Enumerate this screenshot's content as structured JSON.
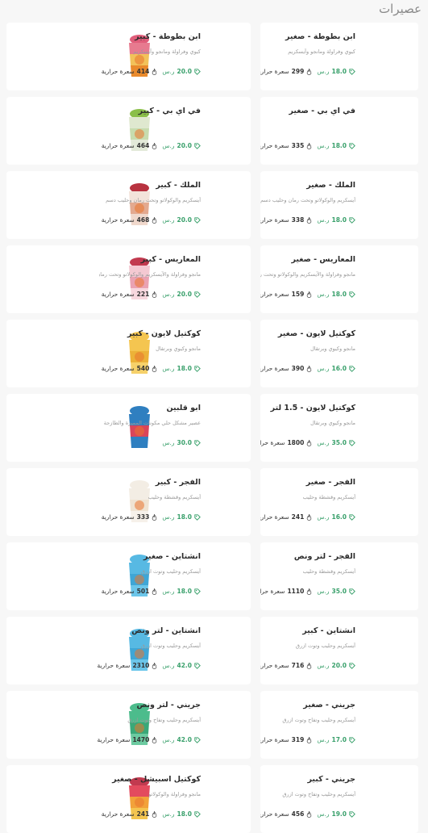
{
  "section": {
    "title": "عصيرات"
  },
  "colors": {
    "price": "#39a06b",
    "card": "#ffffff",
    "bg": "#f7f7f7"
  },
  "items": [
    {
      "name": "ابن بطوطة - صغير",
      "desc": "كيوي وفراولة ومانجو وآيسكريم",
      "price": "18.0",
      "currency": "ر.س",
      "calories": "299",
      "cal_label": "سعرة حرارية",
      "cup": [
        "#e77a8f",
        "#f2c25a",
        "#e98a2c"
      ],
      "top": "#e05d7a"
    },
    {
      "name": "ابن بطوطة - كبير",
      "desc": "كيوي وفراولة ومانجو وآيسكريم",
      "price": "20.0",
      "currency": "ر.س",
      "calories": "414",
      "cal_label": "سعرة حرارية",
      "cup": [
        "#e77a8f",
        "#f2c25a",
        "#e98a2c"
      ],
      "top": "#e05d7a"
    },
    {
      "name": "في اي بي - صغير",
      "desc": "",
      "price": "18.0",
      "currency": "ر.س",
      "calories": "335",
      "cal_label": "سعرة حرارية",
      "cup": [
        "#dfe8cf",
        "#c7dcae",
        "#e3ead9"
      ],
      "top": "#8bbf4a"
    },
    {
      "name": "في اي بي - كبير",
      "desc": "",
      "price": "20.0",
      "currency": "ر.س",
      "calories": "464",
      "cal_label": "سعرة حرارية",
      "cup": [
        "#dfe8cf",
        "#c7dcae",
        "#e3ead9"
      ],
      "top": "#8bbf4a"
    },
    {
      "name": "الملك - صغير",
      "desc": "آيسكريم والوكولاتو وتحت رمان وحليب دسم",
      "price": "18.0",
      "currency": "ر.س",
      "calories": "338",
      "cal_label": "سعرة حرارية",
      "cup": [
        "#f3e3da",
        "#e3a98f",
        "#f0d8cc"
      ],
      "top": "#b8323f"
    },
    {
      "name": "الملك - كبير",
      "desc": "آيسكريم والوكولاتو وتحت رمان وحليب دسم",
      "price": "20.0",
      "currency": "ر.س",
      "calories": "468",
      "cal_label": "سعرة حرارية",
      "cup": [
        "#f3e3da",
        "#e3a98f",
        "#f0d8cc"
      ],
      "top": "#b8323f"
    },
    {
      "name": "المعاريس - صغير",
      "desc": "مانجو وفراولة والآيسكريم والوكولاتو وتحت رمان",
      "price": "18.0",
      "currency": "ر.س",
      "calories": "159",
      "cal_label": "سعرة حرارية",
      "cup": [
        "#f4c9d2",
        "#eaa2b2",
        "#f7d7de"
      ],
      "top": "#c23a4f"
    },
    {
      "name": "المعاريس - كبير",
      "desc": "مانجو وفراولة والآيسكريم والوكولاتو وتحت رمان",
      "price": "20.0",
      "currency": "ر.س",
      "calories": "221",
      "cal_label": "سعرة حرارية",
      "cup": [
        "#f4c9d2",
        "#eaa2b2",
        "#f7d7de"
      ],
      "top": "#c23a4f"
    },
    {
      "name": "كوكتيل لايون - صغير",
      "desc": "مانجو وكيوي وبرتقال",
      "price": "16.0",
      "currency": "ر.س",
      "calories": "390",
      "cal_label": "سعرة حرارية",
      "cup": [
        "#f4c550",
        "#ecb238",
        "#f6d16a"
      ],
      "top": "#f4c550"
    },
    {
      "name": "كوكتيل لايون - كبير",
      "desc": "مانجو وكيوي وبرتقال",
      "price": "18.0",
      "currency": "ر.س",
      "calories": "540",
      "cal_label": "سعرة حرارية",
      "cup": [
        "#f4c550",
        "#ecb238",
        "#f6d16a"
      ],
      "top": "#f4c550"
    },
    {
      "name": "كوكتيل لايون - 1.5 لتر",
      "desc": "مانجو وكيوي وبرتقال",
      "price": "35.0",
      "currency": "ر.س",
      "calories": "1800",
      "cal_label": "سعرة حرارية",
      "cup": [
        "#f6d86a",
        "#f1c94d",
        "#f8e08a"
      ],
      "top": "#f6d86a"
    },
    {
      "name": "ابو قلبين",
      "desc": "عصير مشكل حلي مكونات المميزة والطازجة",
      "price": "30.0",
      "currency": "ر.س",
      "calories": "",
      "cal_label": "",
      "cup": [
        "#2f7fc0",
        "#d9455a",
        "#2f7fc0"
      ],
      "top": "#2f7fc0"
    },
    {
      "name": "الفجر - صغير",
      "desc": "آيسكريم وقشطة وحليب",
      "price": "16.0",
      "currency": "ر.س",
      "calories": "241",
      "cal_label": "سعرة حرارية",
      "cup": [
        "#f3ede4",
        "#efe3d2",
        "#f6f1ea"
      ],
      "top": "#f3ede4"
    },
    {
      "name": "الفجر - كبير",
      "desc": "آيسكريم وقشطة وحليب",
      "price": "18.0",
      "currency": "ر.س",
      "calories": "333",
      "cal_label": "سعرة حرارية",
      "cup": [
        "#f3ede4",
        "#efe3d2",
        "#f6f1ea"
      ],
      "top": "#f3ede4"
    },
    {
      "name": "الفجر - لتر ونص",
      "desc": "آيسكريم وقشطة وحليب",
      "price": "35.0",
      "currency": "ر.س",
      "calories": "1110",
      "cal_label": "سعرة حرارية",
      "cup": [
        "#f3ede4",
        "#efe3d2",
        "#f6f1ea"
      ],
      "top": "#f3ede4"
    },
    {
      "name": "انشتاين - صغير",
      "desc": "آيسكريم وحليب وتوت ازرق",
      "price": "18.0",
      "currency": "ر.س",
      "calories": "501",
      "cal_label": "سعرة حرارية",
      "cup": [
        "#57b9e3",
        "#3fa6d6",
        "#6cc6ea"
      ],
      "top": "#57b9e3"
    },
    {
      "name": "انشتاين - كبير",
      "desc": "آيسكريم وحليب وتوت ازرق",
      "price": "20.0",
      "currency": "ر.س",
      "calories": "716",
      "cal_label": "سعرة حرارية",
      "cup": [
        "#57b9e3",
        "#3fa6d6",
        "#6cc6ea"
      ],
      "top": "#57b9e3"
    },
    {
      "name": "انشتاين - لتر ونص",
      "desc": "آيسكريم وحليب وتوت ازرق",
      "price": "42.0",
      "currency": "ر.س",
      "calories": "2310",
      "cal_label": "سعرة حرارية",
      "cup": [
        "#57b9e3",
        "#3fa6d6",
        "#6cc6ea"
      ],
      "top": "#57b9e3"
    },
    {
      "name": "جريني - صغير",
      "desc": "آيسكريم وحليب وتفاح وتوت ازرق",
      "price": "17.0",
      "currency": "ر.س",
      "calories": "319",
      "cal_label": "سعرة حرارية",
      "cup": [
        "#4cbc8c",
        "#3aa878",
        "#6ccaa0"
      ],
      "top": "#4cbc8c"
    },
    {
      "name": "جريني - لتر ونص",
      "desc": "آيسكريم وحليب وتفاح وتوت ازرق",
      "price": "42.0",
      "currency": "ر.س",
      "calories": "1470",
      "cal_label": "سعرة حرارية",
      "cup": [
        "#4cbc8c",
        "#3aa878",
        "#6ccaa0"
      ],
      "top": "#4cbc8c"
    },
    {
      "name": "جريني - كبير",
      "desc": "آيسكريم وحليب وتفاح وتوت ازرق",
      "price": "19.0",
      "currency": "ر.س",
      "calories": "456",
      "cal_label": "سعرة حرارية",
      "cup": [
        "#4cbc8c",
        "#3aa878",
        "#6ccaa0"
      ],
      "top": "#4cbc8c"
    },
    {
      "name": "كوكتيل اسبيشل - صغير",
      "desc": "مانجو وفراولة والوكولاتو",
      "price": "18.0",
      "currency": "ر.س",
      "calories": "241",
      "cal_label": "سعرة حرارية",
      "cup": [
        "#e34b5e",
        "#f2a23a",
        "#f4c550"
      ],
      "top": "#c23a4f"
    }
  ]
}
